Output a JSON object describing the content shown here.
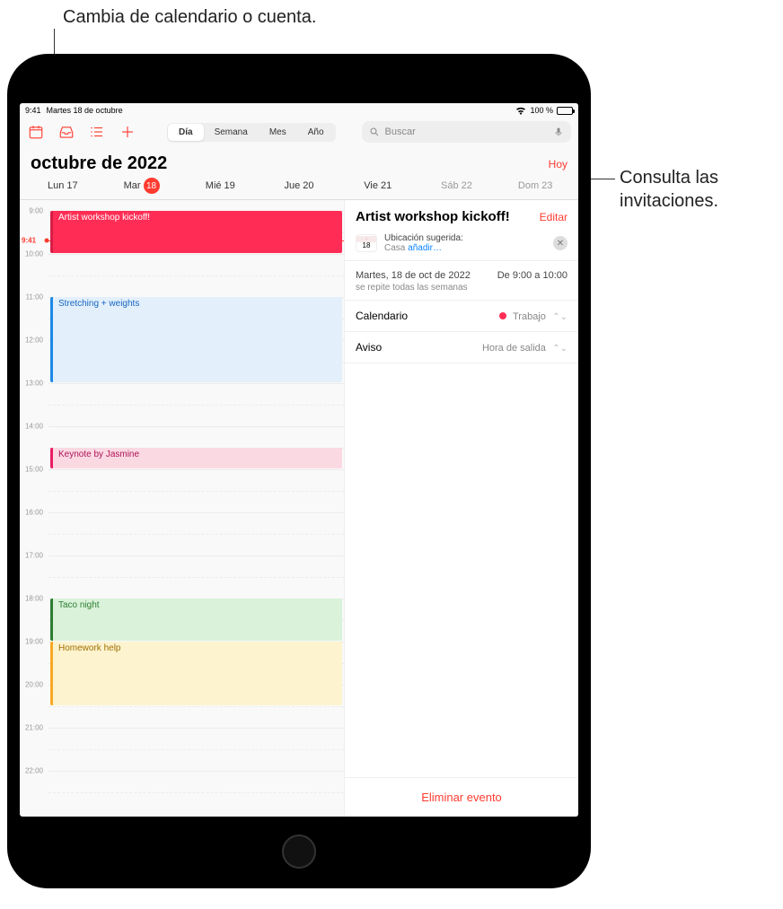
{
  "callouts": {
    "top": "Cambia de calendario o cuenta.",
    "right_line1": "Consulta las",
    "right_line2": "invitaciones."
  },
  "status": {
    "time": "9:41",
    "date": "Martes 18 de octubre",
    "battery": "100 %"
  },
  "toolbar": {
    "segments": {
      "day": "Día",
      "week": "Semana",
      "month": "Mes",
      "year": "Año"
    },
    "search_placeholder": "Buscar"
  },
  "header": {
    "month_title": "octubre de 2022",
    "today": "Hoy"
  },
  "days": [
    {
      "label": "Lun",
      "num": "17"
    },
    {
      "label": "Mar",
      "num": "18",
      "selected": true
    },
    {
      "label": "Mié",
      "num": "19"
    },
    {
      "label": "Jue",
      "num": "20"
    },
    {
      "label": "Vie",
      "num": "21"
    },
    {
      "label": "Sáb",
      "num": "22",
      "weekend": true
    },
    {
      "label": "Dom",
      "num": "23",
      "weekend": true
    }
  ],
  "timeline": {
    "hours": [
      "9:00",
      "10:00",
      "11:00",
      "12:00",
      "13:00",
      "14:00",
      "15:00",
      "16:00",
      "17:00",
      "18:00",
      "19:00",
      "20:00",
      "21:00",
      "22:00"
    ],
    "now_label": "9:41",
    "events": [
      {
        "title": "Artist workshop kickoff!",
        "start": 9,
        "end": 10,
        "cls": "ev-pink"
      },
      {
        "title": "Stretching + weights",
        "start": 11,
        "end": 13,
        "cls": "ev-blue"
      },
      {
        "title": "Keynote by Jasmine",
        "start": 14.5,
        "end": 15,
        "cls": "ev-rose"
      },
      {
        "title": "Taco night",
        "start": 18,
        "end": 19,
        "cls": "ev-green"
      },
      {
        "title": "Homework help",
        "start": 19,
        "end": 20.5,
        "cls": "ev-yellow"
      }
    ]
  },
  "detail": {
    "title": "Artist workshop kickoff!",
    "edit": "Editar",
    "suggest_label": "Ubicación sugerida:",
    "suggest_place": "Casa",
    "suggest_link": "añadir…",
    "chip_num": "18",
    "date_line": "Martes, 18 de oct de 2022",
    "time_line": "De 9:00 a 10:00",
    "repeat_line": "se repite todas las semanas",
    "calendar_label": "Calendario",
    "calendar_value": "Trabajo",
    "alert_label": "Aviso",
    "alert_value": "Hora de salida",
    "delete": "Eliminar evento"
  }
}
